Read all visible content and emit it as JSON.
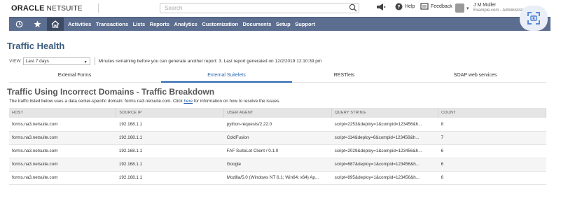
{
  "brand": {
    "oracle": "ORACLE",
    "netsuite": "NETSUITE"
  },
  "search": {
    "placeholder": "Search"
  },
  "toolbar": {
    "help": "Help",
    "feedback": "Feedback"
  },
  "user": {
    "name": "J M Muller",
    "account": "Example.com - Administrator"
  },
  "nav": {
    "items": [
      "Activities",
      "Transactions",
      "Lists",
      "Reports",
      "Analytics",
      "Customization",
      "Documents",
      "Setup",
      "Support"
    ]
  },
  "page": {
    "title": "Traffic Health",
    "view_label": "VIEW",
    "view_value": "Last 7 days",
    "info": "Minutes remaining before you can generate another report: 3.  Last report generated on 12/2/2019 12:10:39 pm"
  },
  "tabs": [
    "External Forms",
    "External Suitelets",
    "RESTlets",
    "SOAP web services"
  ],
  "section": {
    "title": "Traffic Using Incorrect Domains - Traffic Breakdown",
    "desc_before": "The traffic listed below uses a data center-specific domain: forms.na3.netsuite.com. Click ",
    "desc_link": "here",
    "desc_after": " for information on how to resolve the issues."
  },
  "table": {
    "headers": [
      "HOST",
      "SOURCE IP",
      "USER AGENT",
      "QUERY STRING",
      "COUNT"
    ],
    "rows": [
      [
        "forms.na3.netsuite.com",
        "192.168.1.1",
        "python-requests/2.22.0",
        "script=2253&deploy=1&compid=123456&h...",
        "8"
      ],
      [
        "forms.na3.netsuite.com",
        "192.168.1.1",
        "ColdFusion",
        "script=114&deploy=6&compid=123456&h...",
        "7"
      ],
      [
        "forms.na3.netsuite.com",
        "192.168.1.1",
        "FAF SuiteLet Client / 0.1.0",
        "script=2029&deploy=1&compid=123456&h...",
        "6"
      ],
      [
        "forms.na3.netsuite.com",
        "192.168.1.1",
        "Google",
        "script=687&deploy=1&compid=123456&h...",
        "6"
      ],
      [
        "forms.na3.netsuite.com",
        "192.168.1.1",
        "Mozilla/5.0 (Windows NT 6.1; Win64; x64) Ap...",
        "script=895&deploy=1&compid=123456&h...",
        "6"
      ]
    ]
  },
  "colors": {
    "nav_bg": "#5c6e8f",
    "title": "#3a5a7f",
    "accent": "#2a67b2"
  }
}
